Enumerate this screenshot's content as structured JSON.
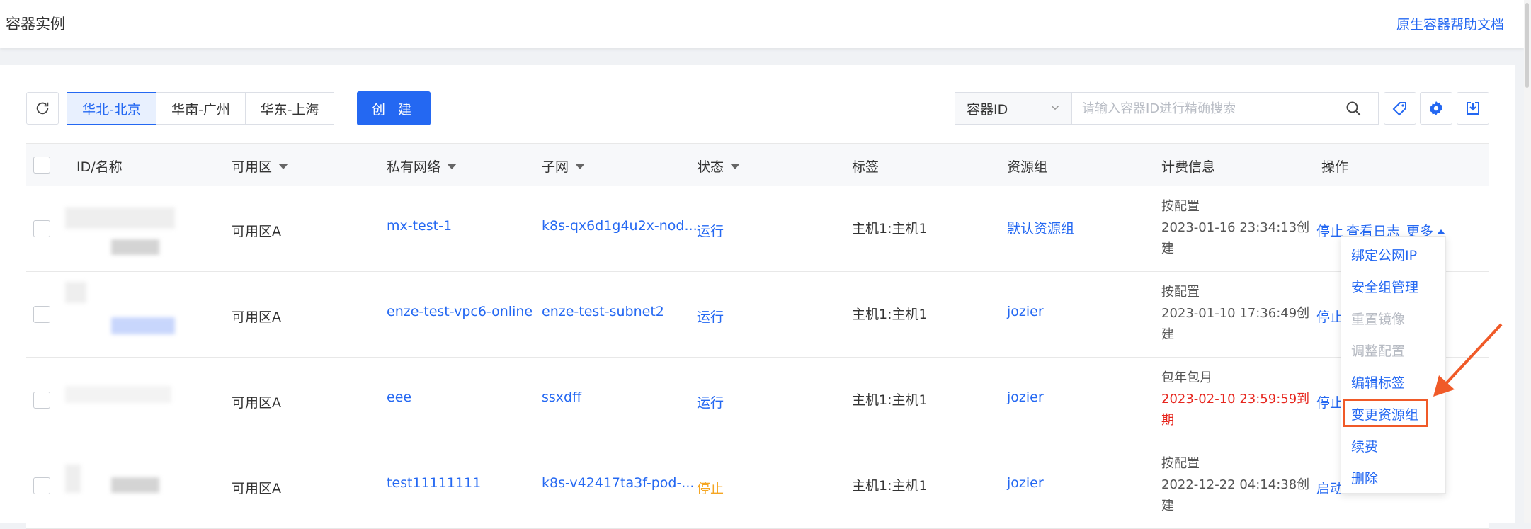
{
  "header": {
    "title": "容器实例",
    "help_link": "原生容器帮助文档"
  },
  "toolbar": {
    "regions": [
      "华北-北京",
      "华南-广州",
      "华东-上海"
    ],
    "active_region": "华北-北京",
    "create_label": "创 建",
    "search_field_select": "容器ID",
    "search_placeholder": "请输入容器ID进行精确搜索"
  },
  "table": {
    "headers": {
      "id_name": "ID/名称",
      "zone": "可用区",
      "vpc": "私有网络",
      "subnet": "子网",
      "status": "状态",
      "tags": "标签",
      "resource_group": "资源组",
      "billing": "计费信息",
      "actions": "操作"
    },
    "rows": [
      {
        "zone": "可用区A",
        "vpc": "mx-test-1",
        "subnet": "k8s-qx6d1g4u2x-nod...",
        "status": "运行",
        "tags": "主机1:主机1",
        "resource_group": "默认资源组",
        "billing_mode": "按配置",
        "billing_time": "2023-01-16 23:34:13创建",
        "actions": [
          "停止",
          "查看日志",
          "更多"
        ]
      },
      {
        "zone": "可用区A",
        "vpc": "enze-test-vpc6-online",
        "subnet": "enze-test-subnet2",
        "status": "运行",
        "tags": "主机1:主机1",
        "resource_group": "jozier",
        "billing_mode": "按配置",
        "billing_time": "2023-01-10 17:36:49创建",
        "actions": [
          "停止"
        ]
      },
      {
        "zone": "可用区A",
        "vpc": "eee",
        "subnet": "ssxdff",
        "status": "运行",
        "tags": "主机1:主机1",
        "resource_group": "jozier",
        "billing_mode": "包年包月",
        "billing_time": "2023-02-10 23:59:59到期",
        "actions": [
          "停止"
        ]
      },
      {
        "zone": "可用区A",
        "vpc": "test11111111",
        "subnet": "k8s-v42417ta3f-pod-...",
        "status": "停止",
        "tags": "主机1:主机1",
        "resource_group": "jozier",
        "billing_mode": "按配置",
        "billing_time": "2022-12-22 04:14:38创建",
        "actions": [
          "启动"
        ]
      }
    ]
  },
  "more_menu": {
    "items": [
      {
        "label": "绑定公网IP",
        "disabled": false
      },
      {
        "label": "安全组管理",
        "disabled": false
      },
      {
        "label": "重置镜像",
        "disabled": true
      },
      {
        "label": "调整配置",
        "disabled": true
      },
      {
        "label": "编辑标签",
        "disabled": false
      },
      {
        "label": "变更资源组",
        "disabled": false,
        "highlighted": true
      },
      {
        "label": "续费",
        "disabled": false
      },
      {
        "label": "删除",
        "disabled": false
      }
    ]
  },
  "colors": {
    "primary": "#2468f2",
    "warning": "#f5a623",
    "danger": "#e6261e",
    "annotation": "#f05a28"
  }
}
